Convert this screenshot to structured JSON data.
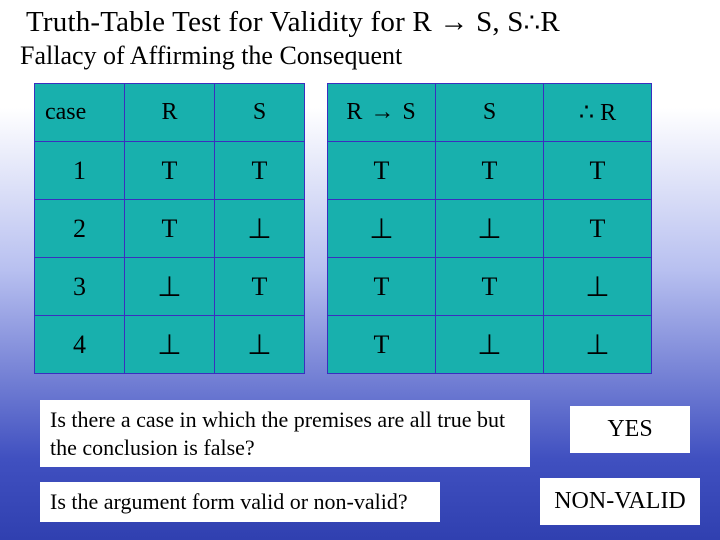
{
  "title_prefix": "Truth-Table Test for Validity for R",
  "title_arrow": "→",
  "title_mid": "S,  S",
  "title_therefore": "∴",
  "title_end": "R",
  "subtitle": "Fallacy of Affirming the Consequent",
  "table1": {
    "headers": [
      "case",
      "R",
      "S"
    ],
    "rows": [
      [
        "1",
        "T",
        "T"
      ],
      [
        "2",
        "T",
        "⊥"
      ],
      [
        "3",
        "⊥",
        "T"
      ],
      [
        "4",
        "⊥",
        "⊥"
      ]
    ]
  },
  "table2": {
    "headers": [
      "R → S",
      "S",
      "∴ R"
    ],
    "rows": [
      [
        "T",
        "T",
        "T"
      ],
      [
        "⊥",
        "⊥",
        "T"
      ],
      [
        "T",
        "T",
        "⊥"
      ],
      [
        "T",
        "⊥",
        "⊥"
      ]
    ]
  },
  "question1": "Is there a case in which the premises are all true but the conclusion is false?",
  "answer1": "YES",
  "question2": "Is the argument form valid or non-valid?",
  "answer2": "NON-VALID",
  "chart_data": {
    "type": "table",
    "title": "Truth-Table Test for Validity for R → S, S ∴ R (Fallacy of Affirming the Consequent)",
    "columns": [
      "case",
      "R",
      "S",
      "R → S",
      "S (premise)",
      "∴ R (conclusion)"
    ],
    "rows": [
      {
        "case": 1,
        "R": "T",
        "S": "T",
        "R→S": "T",
        "S_premise": "T",
        "conclusion_R": "T"
      },
      {
        "case": 2,
        "R": "T",
        "S": "⊥",
        "R→S": "⊥",
        "S_premise": "⊥",
        "conclusion_R": "T"
      },
      {
        "case": 3,
        "R": "⊥",
        "S": "T",
        "R→S": "T",
        "S_premise": "T",
        "conclusion_R": "⊥"
      },
      {
        "case": 4,
        "R": "⊥",
        "S": "⊥",
        "R→S": "T",
        "S_premise": "⊥",
        "conclusion_R": "⊥"
      }
    ],
    "counterexample_exists": "YES",
    "validity": "NON-VALID"
  }
}
